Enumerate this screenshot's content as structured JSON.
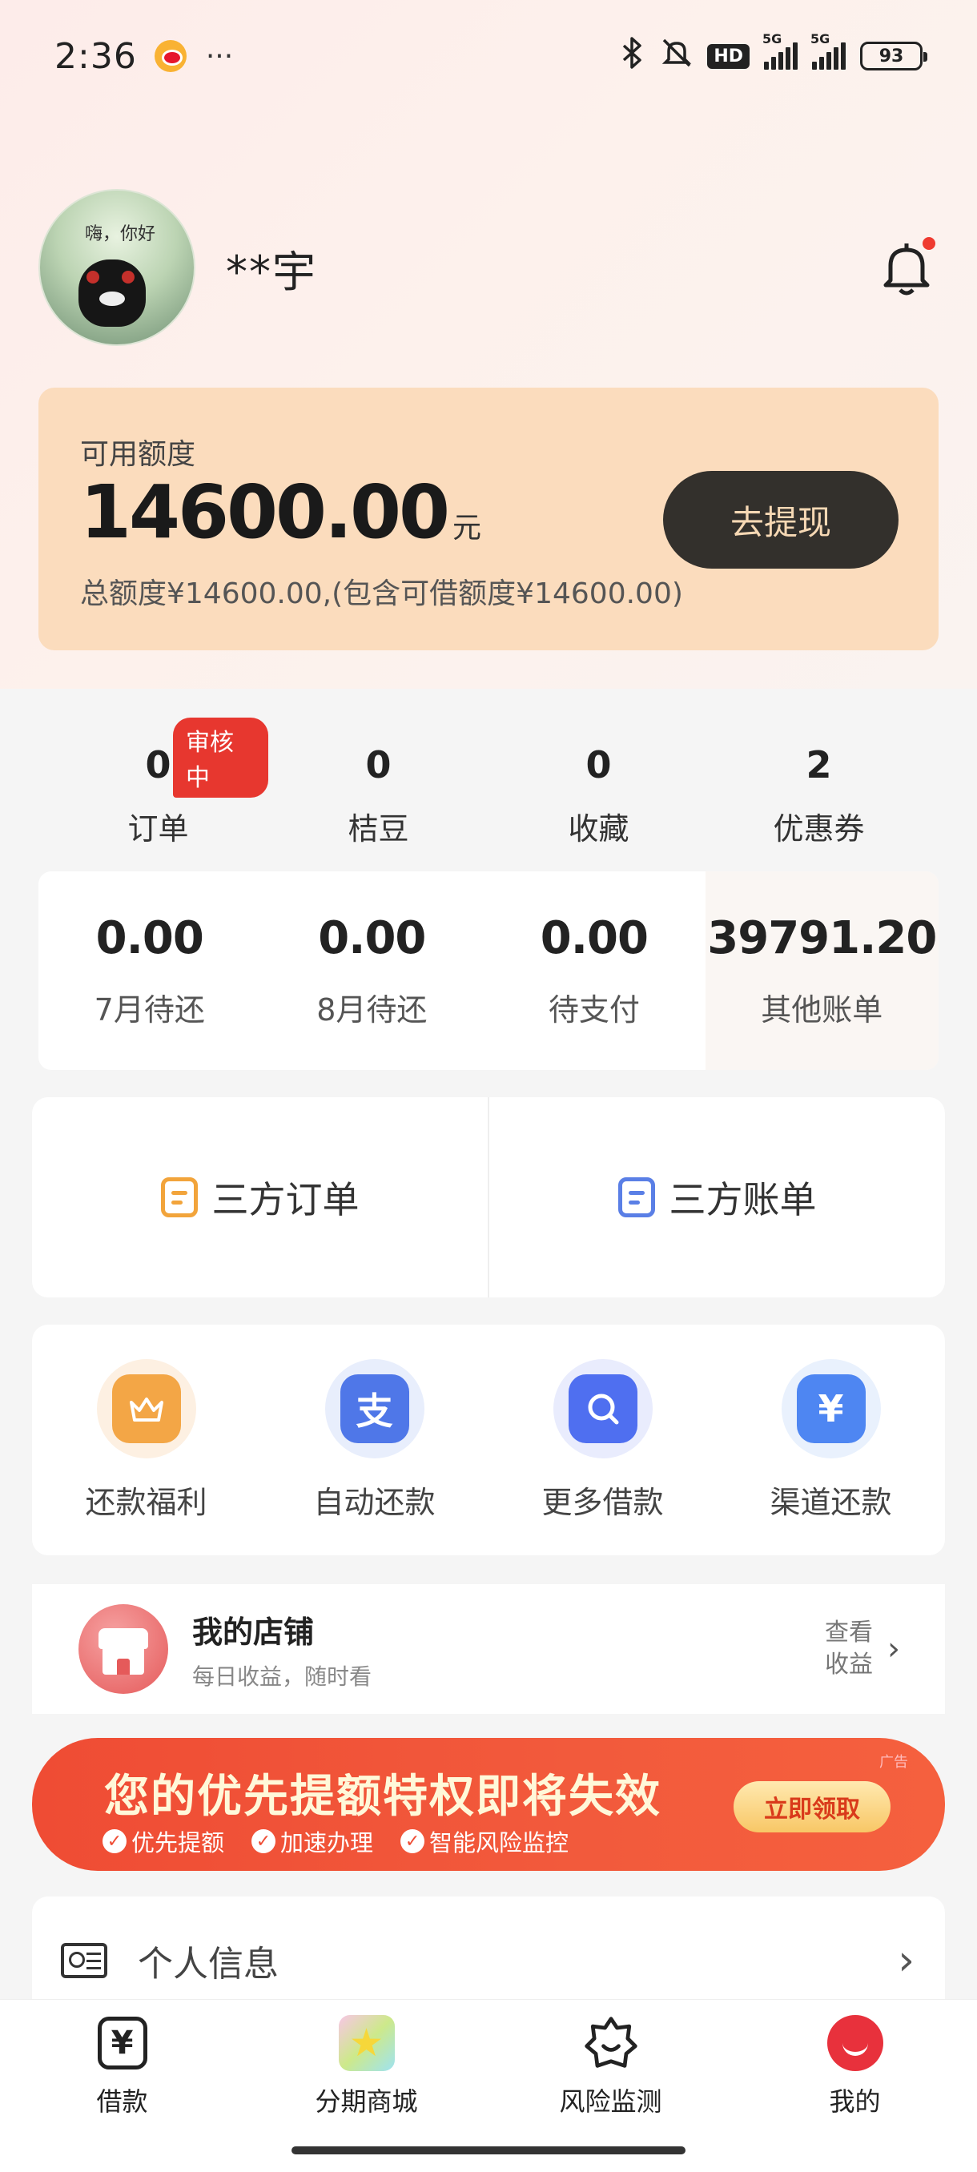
{
  "status_bar": {
    "time": "2:36",
    "dots": "···",
    "hd_label": "HD",
    "network_1": "5G",
    "network_2": "5G",
    "battery": "93"
  },
  "profile": {
    "username": "**宇",
    "avatar_text": "嗨，你好"
  },
  "credit": {
    "label": "可用额度",
    "amount": "14600.00",
    "unit": "元",
    "subtitle": "总额度¥14600.00,(包含可借额度¥14600.00)",
    "withdraw_button": "去提现"
  },
  "stats": [
    {
      "value": "0",
      "label": "订单",
      "badge": "审核中"
    },
    {
      "value": "0",
      "label": "桔豆"
    },
    {
      "value": "0",
      "label": "收藏"
    },
    {
      "value": "2",
      "label": "优惠券"
    }
  ],
  "bills": [
    {
      "value": "0.00",
      "label": "7月待还"
    },
    {
      "value": "0.00",
      "label": "8月待还"
    },
    {
      "value": "0.00",
      "label": "待支付"
    },
    {
      "value": "39791.20",
      "label": "其他账单"
    }
  ],
  "third_party": {
    "orders_label": "三方订单",
    "bills_label": "三方账单"
  },
  "shortcuts": [
    {
      "label": "还款福利",
      "icon": "crown-icon",
      "color": "#f3a646",
      "halo": "#fdf0e2"
    },
    {
      "label": "自动还款",
      "icon": "alipay-icon",
      "color": "#4f77e8",
      "halo": "#e8eefc"
    },
    {
      "label": "更多借款",
      "icon": "search-icon",
      "color": "#4f6ff0",
      "halo": "#e9ecfd"
    },
    {
      "label": "渠道还款",
      "icon": "yen-icon",
      "color": "#4e86f2",
      "halo": "#e9f1fd"
    }
  ],
  "shop": {
    "title": "我的店铺",
    "subtitle": "每日收益，随时看",
    "link": "查看收益"
  },
  "promo": {
    "title": "您的优先提额特权即将失效",
    "tags": [
      "优先提额",
      "加速办理",
      "智能风险监控"
    ],
    "button": "立即领取",
    "ad_label": "广告"
  },
  "personal_info": {
    "label": "个人信息"
  },
  "tab_bar": {
    "items": [
      {
        "label": "借款",
        "icon": "loan-icon"
      },
      {
        "label": "分期商城",
        "icon": "mall-icon"
      },
      {
        "label": "风险监测",
        "icon": "risk-icon"
      },
      {
        "label": "我的",
        "icon": "me-icon"
      }
    ]
  }
}
